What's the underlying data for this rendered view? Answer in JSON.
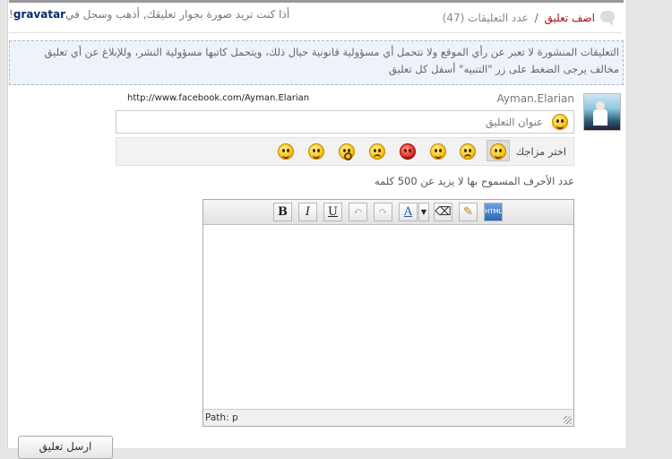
{
  "header": {
    "add_comment": "اضف تعليق",
    "separator": "/",
    "comments_count": "عدد التعليقات (47)",
    "gravatar_prefix": "أذا كنت تريد صورة بجوار تعليقك, أذهب وسجل في",
    "gravatar_link": "gravatar",
    "gravatar_suffix": "!"
  },
  "notice": {
    "text": "التعليقات المنشورة لا تعبر عن رأي الموقع ولا نتحمل أي مسؤولية قانونية حيال ذلك، ويتحمل كاتبها مسؤولية النشر، وللإبلاغ عن أي تعليق مخالف يرجى الضغط على زر \"التنبيه\" أسفل كل تعليق"
  },
  "user": {
    "name": "Ayman.Elarian",
    "link": "http://www.facebook.com/Ayman.Elarian"
  },
  "form": {
    "title_label": "عنوان التعليق",
    "mood_label": "اختر مزاجك",
    "moods": [
      "smile-selected",
      "sad",
      "wink",
      "angry",
      "worried",
      "surprised",
      "grin",
      "laughing"
    ],
    "limit_text": "عدد الأحرف المسموح بها لا يزيد عن 500 كلمه",
    "submit_label": "ارسل تعليق"
  },
  "editor": {
    "toolbar": {
      "bold": "B",
      "italic": "I",
      "underline": "U",
      "html": "HTML"
    },
    "path_label": "Path:",
    "path_value": "p"
  },
  "colors": {
    "accent_red": "#a31515",
    "gravatar_blue": "#0a2a6b",
    "notice_bg": "#eef2fa",
    "notice_border": "#a9b8d4"
  }
}
